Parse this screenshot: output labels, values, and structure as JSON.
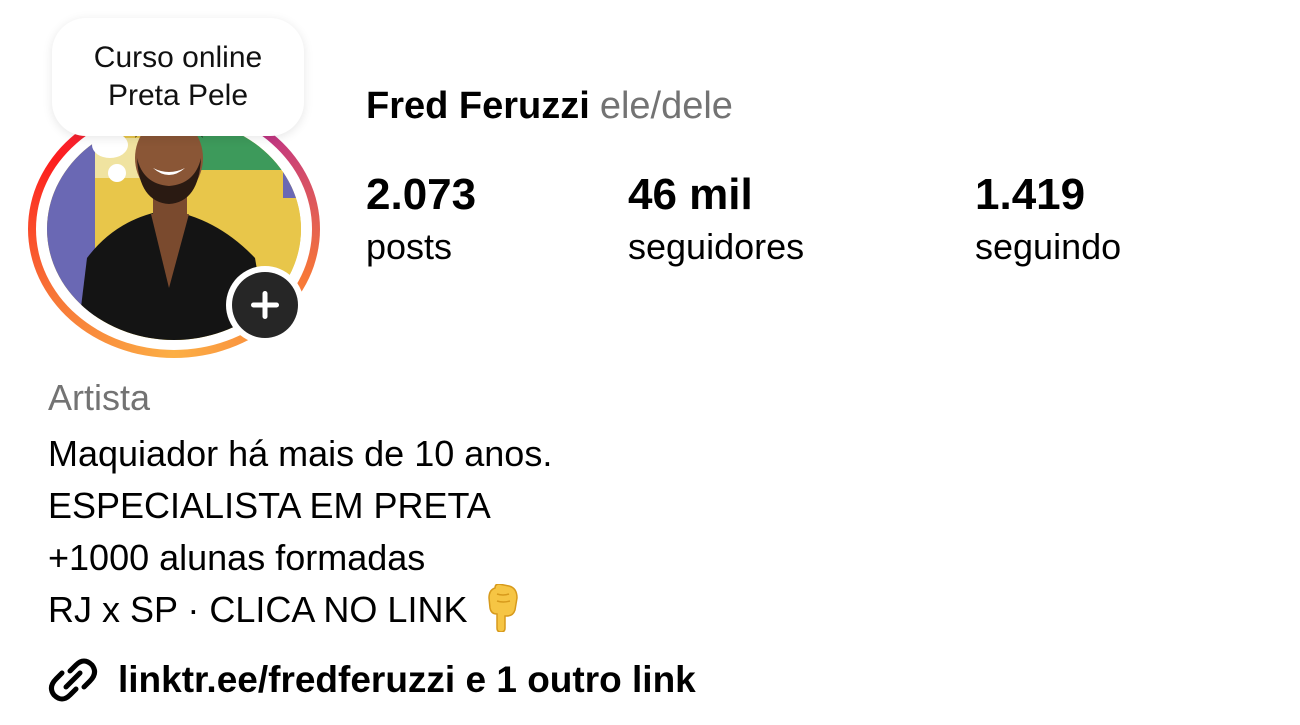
{
  "note": {
    "line1": "Curso online",
    "line2": "Preta Pele"
  },
  "profile": {
    "display_name": "Fred Feruzzi",
    "pronouns": "ele/dele"
  },
  "stats": {
    "posts": {
      "value": "2.073",
      "label": "posts"
    },
    "followers": {
      "value": "46 mil",
      "label": "seguidores"
    },
    "following": {
      "value": "1.419",
      "label": "seguindo"
    }
  },
  "bio": {
    "category": "Artista",
    "lines": [
      "Maquiador há mais de 10 anos.",
      "ESPECIALISTA EM PRETA",
      "+1000 alunas formadas",
      "RJ x SP · CLICA NO LINK"
    ],
    "emoji_icon": "pointing-down-hand-icon"
  },
  "link": {
    "text": "linktr.ee/fredferuzzi e 1 outro link",
    "icon": "link-chain-icon"
  },
  "colors": {
    "muted_text": "#737373",
    "add_button": "#262626",
    "ring_gradient": [
      "#fcaf45",
      "#f77737",
      "#fd1d1d",
      "#e1306c",
      "#c13584"
    ]
  }
}
